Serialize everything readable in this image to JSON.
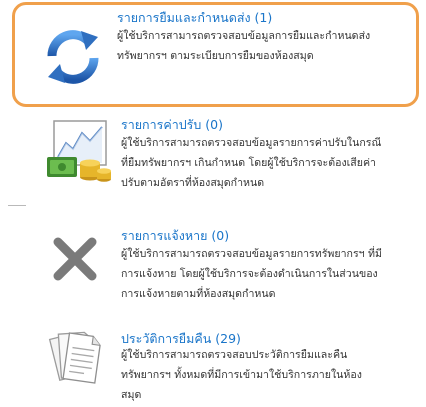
{
  "items": [
    {
      "title": "รายการยืมและกำหนดส่ง (1)",
      "desc_line1": "ผู้ใช้บริการสามารถตรวจสอบข้อมูลการยืมและกำหนดส่ง",
      "desc_line2": "ทรัพยากรฯ ตามระเบียบการยืมของห้องสมุด",
      "icon": "refresh-arrows-icon"
    },
    {
      "title": "รายการค่าปรับ (0)",
      "desc_line1": "ผู้ใช้บริการสามารถตรวจสอบข้อมูลรายการค่าปรับในกรณี",
      "desc_line2": "ที่ยืมทรัพยากรฯ เกินกำหนด โดยผู้ใช้บริการจะต้องเสียค่า",
      "desc_line3": "ปรับตามอัตราที่ห้องสมุดกำหนด",
      "icon": "money-chart-icon"
    },
    {
      "title": "รายการแจ้งหาย (0)",
      "desc_line1": "ผู้ใช้บริการสามารถตรวจสอบข้อมูลรายการทรัพยากรฯ ที่มี",
      "desc_line2": "การแจ้งหาย โดยผู้ใช้บริการจะต้องดำเนินการในส่วนของ",
      "desc_line3": "การแจ้งหายตามที่ห้องสมุดกำหนด",
      "icon": "x-mark-icon"
    },
    {
      "title": "ประวัติการยืมคืน (29)",
      "desc_line1": "ผู้ใช้บริการสามารถตรวจสอบประวัติการยืมและคืน",
      "desc_line2": "ทรัพยากรฯ ทั้งหมดที่มีการเข้ามาใช้บริการภายในห้อง",
      "desc_line3": "สมุด",
      "icon": "documents-icon"
    }
  ],
  "colors": {
    "highlight_border": "#f0a04b",
    "title_link": "#1a75c9",
    "refresh_blue": "#2f6fc0",
    "x_gray": "#7a7a7a"
  }
}
